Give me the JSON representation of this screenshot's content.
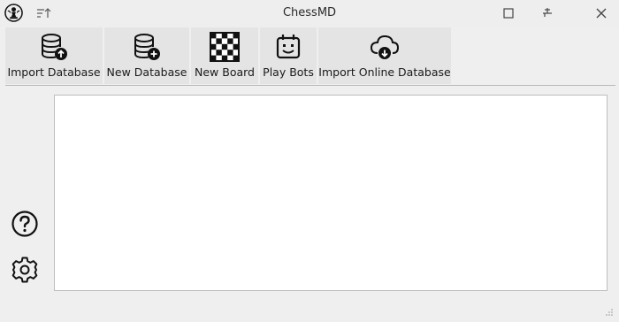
{
  "window": {
    "title": "ChessMD"
  },
  "titlebar": {
    "app_icon": "chess-pawn-icon",
    "menu_icon": "sort-menu-icon",
    "buttons": [
      "maximize-icon",
      "keep-above-icon",
      "close-icon"
    ]
  },
  "toolbar": {
    "items": [
      {
        "label": "Import Database",
        "icon": "database-upload-icon"
      },
      {
        "label": "New Database",
        "icon": "database-add-icon"
      },
      {
        "label": "New Board",
        "icon": "chessboard-icon"
      },
      {
        "label": "Play Bots",
        "icon": "robot-calendar-icon"
      },
      {
        "label": "Import Online Database",
        "icon": "cloud-download-icon"
      }
    ]
  },
  "sidebar": {
    "buttons": [
      {
        "icon": "help-icon"
      },
      {
        "icon": "gear-icon"
      }
    ]
  },
  "colors": {
    "background": "#efefef",
    "toolbar_button": "#e4e4e4",
    "panel": "#ffffff",
    "icon": "#111111"
  }
}
